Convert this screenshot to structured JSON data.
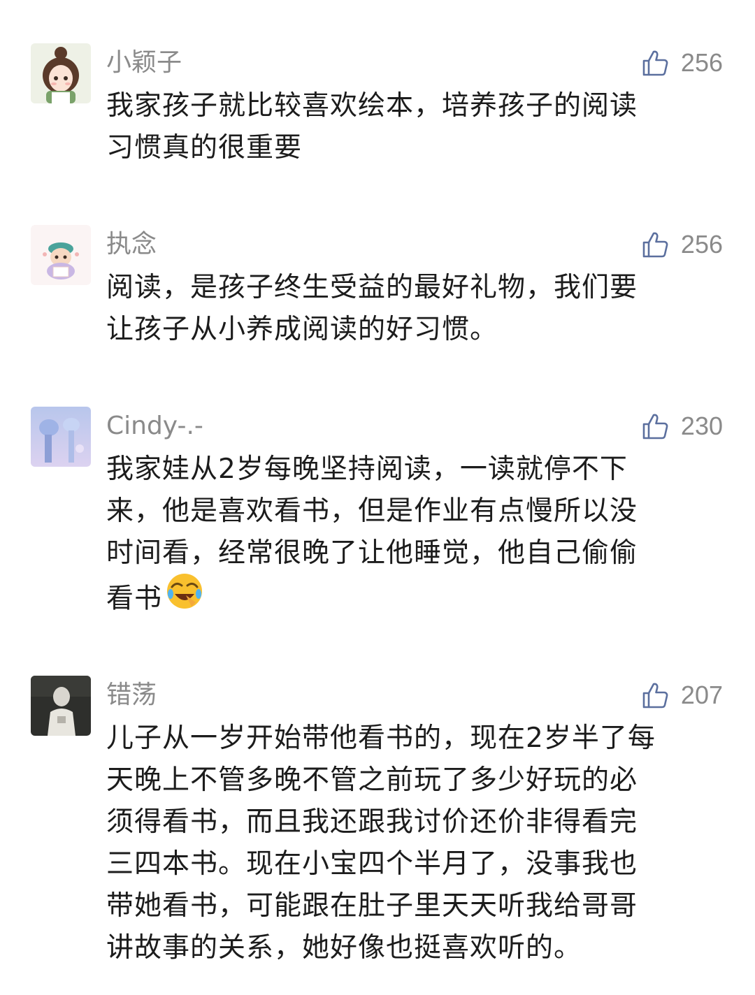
{
  "comments": [
    {
      "username": "小颖子",
      "likes": "256",
      "lines": [
        "我家孩子就比较喜欢绘本，培养孩子的阅读",
        "习惯真的很重要"
      ]
    },
    {
      "username": "执念",
      "likes": "256",
      "lines": [
        "阅读，是孩子终生受益的最好礼物，我们要",
        "让孩子从小养成阅读的好习惯。"
      ]
    },
    {
      "username": "Cindy-.-",
      "likes": "230",
      "lines": [
        "我家娃从2岁每晚坚持阅读，一读就停不下",
        "来，他是喜欢看书，但是作业有点慢所以没",
        "时间看，经常很晚了让他睡觉，他自己偷偷",
        "看书"
      ],
      "emoji": "laughing-crying-emoji"
    },
    {
      "username": "错荡",
      "likes": "207",
      "lines": [
        "儿子从一岁开始带他看书的，现在2岁半了每",
        "天晚上不管多晚不管之前玩了多少好玩的必",
        "须得看书，而且我还跟我讨价还价非得看完",
        "三四本书。现在小宝四个半月了，没事我也",
        "带她看书，可能跟在肚子里天天听我给哥哥",
        "讲故事的关系，她好像也挺喜欢听的。"
      ]
    }
  ],
  "colors": {
    "meta_text": "#8a8a8a",
    "body_text": "#1c1c1c",
    "like_icon": "#5b6f9e"
  },
  "icons": {
    "like": "thumbs-up-icon"
  }
}
